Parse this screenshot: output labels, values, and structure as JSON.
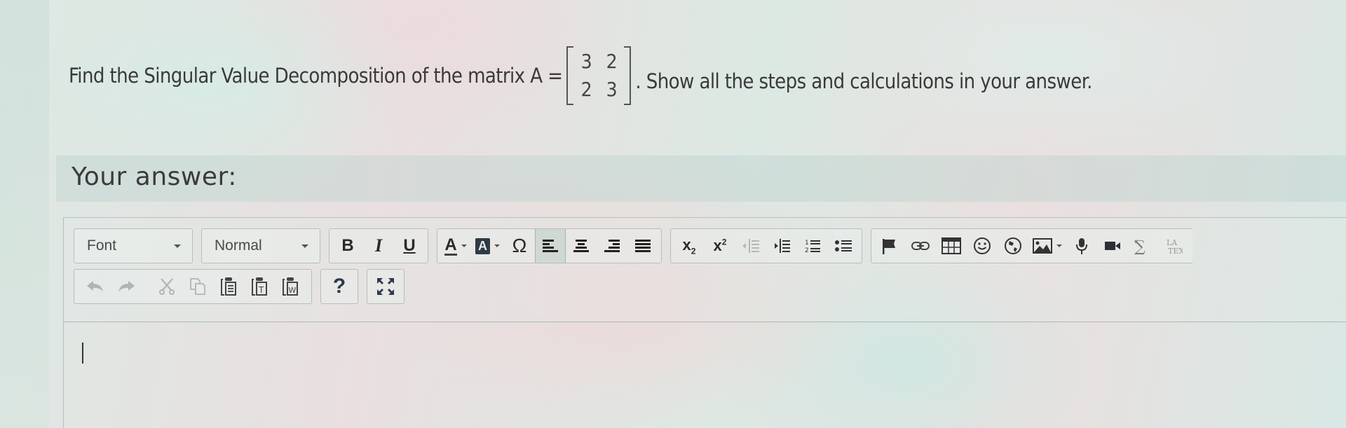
{
  "question": {
    "text_before": "Find the Singular Value Decomposition of the matrix A =",
    "matrix": [
      [
        "3",
        "2"
      ],
      [
        "2",
        "3"
      ]
    ],
    "text_after": ". Show all the steps and calculations  in your answer."
  },
  "answer": {
    "label": "Your answer:",
    "editor_content": ""
  },
  "toolbar": {
    "font_select": {
      "value": "Font"
    },
    "format_select": {
      "value": "Normal"
    },
    "basic_styles": [
      {
        "name": "bold",
        "label": "B"
      },
      {
        "name": "italic",
        "label": "I"
      },
      {
        "name": "underline",
        "label": "U"
      }
    ],
    "text_color_label": "A",
    "bg_color_label": "A",
    "special_char_label": "Ω",
    "alignment": {
      "active": "align-left",
      "items": [
        "align-left",
        "align-center",
        "align-right",
        "align-justify"
      ]
    },
    "script_items": [
      {
        "name": "subscript",
        "label": "x",
        "sub": "2"
      },
      {
        "name": "superscript",
        "label": "x",
        "sup": "2"
      }
    ],
    "indent_items": [
      {
        "name": "outdent",
        "disabled": true
      },
      {
        "name": "indent",
        "disabled": false
      }
    ],
    "list_items": [
      "numbered-list",
      "bulleted-list"
    ],
    "insert_items": [
      "anchor",
      "link",
      "table",
      "smiley",
      "web-link",
      "image",
      "record-audio",
      "record-video",
      "equation",
      "latex"
    ],
    "history_items": [
      {
        "name": "undo",
        "disabled": true
      },
      {
        "name": "redo",
        "disabled": true
      }
    ],
    "clipboard_items": [
      {
        "name": "cut",
        "disabled": true
      },
      {
        "name": "copy",
        "disabled": true
      },
      {
        "name": "paste",
        "disabled": false
      },
      {
        "name": "paste-text",
        "disabled": false
      },
      {
        "name": "paste-word",
        "disabled": false
      }
    ],
    "help_label": "?",
    "maximize": "maximize"
  }
}
